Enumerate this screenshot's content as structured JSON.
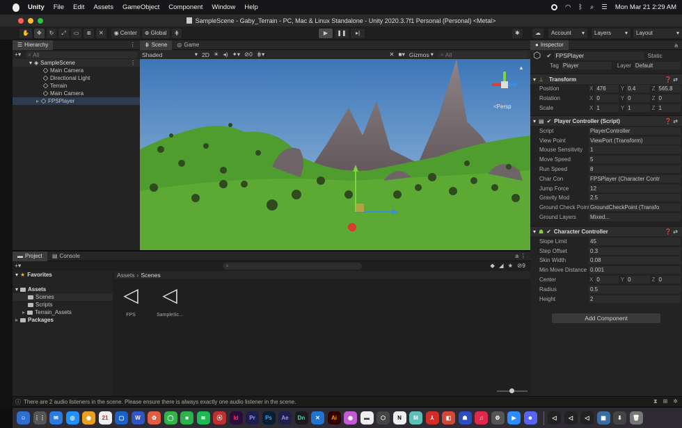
{
  "menubar": {
    "app": "Unity",
    "items": [
      "File",
      "Edit",
      "Assets",
      "GameObject",
      "Component",
      "Window",
      "Help"
    ],
    "clock": "Mon Mar 21  2:29 AM"
  },
  "window": {
    "title": "SampleScene - Gaby_Terrain - PC, Mac & Linux Standalone - Unity 2020.3.7f1 Personal (Personal) <Metal>"
  },
  "toolbar": {
    "pivot": "Center",
    "space": "Global",
    "account": "Account",
    "layers": "Layers",
    "layout": "Layout"
  },
  "hierarchy": {
    "tab": "Hierarchy",
    "search": "All",
    "scene": "SampleScene",
    "items": [
      "Main Camera",
      "Directional Light",
      "Terrain",
      "Main Camera",
      "FPSPlayer"
    ]
  },
  "scene": {
    "tabs": [
      "Scene",
      "Game"
    ],
    "shading": "Shaded",
    "mode2d": "2D",
    "gizmos": "Gizmos",
    "search": "All",
    "hidden_count": "0",
    "persp": "<Persp"
  },
  "project": {
    "tabs": [
      "Project",
      "Console"
    ],
    "favorites": "Favorites",
    "tree": [
      "Assets",
      "Scenes",
      "Scripts",
      "Terrain_Assets",
      "Packages"
    ],
    "breadcrumb": [
      "Assets",
      "Scenes"
    ],
    "assets": [
      "FPS",
      "SampleSc..."
    ],
    "hidden_count": "9"
  },
  "inspector": {
    "tab": "Inspector",
    "object_name": "FPSPlayer",
    "static": "Static",
    "tag": "Player",
    "layer": "Default",
    "transform": {
      "title": "Transform",
      "rows": [
        {
          "label": "Position",
          "x": "476",
          "y": "0.4",
          "z": "565.8"
        },
        {
          "label": "Rotation",
          "x": "0",
          "y": "0",
          "z": "0"
        },
        {
          "label": "Scale",
          "x": "1",
          "y": "1",
          "z": "1"
        }
      ]
    },
    "player_controller": {
      "title": "Player Controller (Script)",
      "rows": [
        {
          "label": "Script",
          "value": "PlayerController"
        },
        {
          "label": "View Point",
          "value": "ViewPort (Transform)"
        },
        {
          "label": "Mouse Sensitivity",
          "value": "1"
        },
        {
          "label": "Move Speed",
          "value": "5"
        },
        {
          "label": "Run Speed",
          "value": "8"
        },
        {
          "label": "Char Con",
          "value": "FPSPlayer (Character Contr"
        },
        {
          "label": "Jump Force",
          "value": "12"
        },
        {
          "label": "Gravity Mod",
          "value": "2.5"
        },
        {
          "label": "Ground Check Point",
          "value": "GroundCheckPoint (Transfo"
        },
        {
          "label": "Ground Layers",
          "value": "Mixed..."
        }
      ]
    },
    "character_controller": {
      "title": "Character Controller",
      "rows": [
        {
          "label": "Slope Limit",
          "value": "45"
        },
        {
          "label": "Step Offset",
          "value": "0.3"
        },
        {
          "label": "Skin Width",
          "value": "0.08"
        },
        {
          "label": "Min Move Distance",
          "value": "0.001"
        },
        {
          "label": "Radius",
          "value": "0.5"
        },
        {
          "label": "Height",
          "value": "2"
        }
      ],
      "center": {
        "label": "Center",
        "x": "0",
        "y": "0",
        "z": "0"
      }
    },
    "add_component": "Add Component"
  },
  "status": {
    "message": "There are 2 audio listeners in the scene. Please ensure there is always exactly one audio listener in the scene."
  },
  "dock": {
    "labels": [
      "21",
      "Id",
      "Pr",
      "Ps",
      "Ae",
      "Dn",
      "Ai",
      "N",
      "M"
    ]
  },
  "colors": {
    "accent": "#2f6fd1",
    "sky": "#5b93cf",
    "grass": "#4c9a2e",
    "mountain": "#7c7277"
  }
}
